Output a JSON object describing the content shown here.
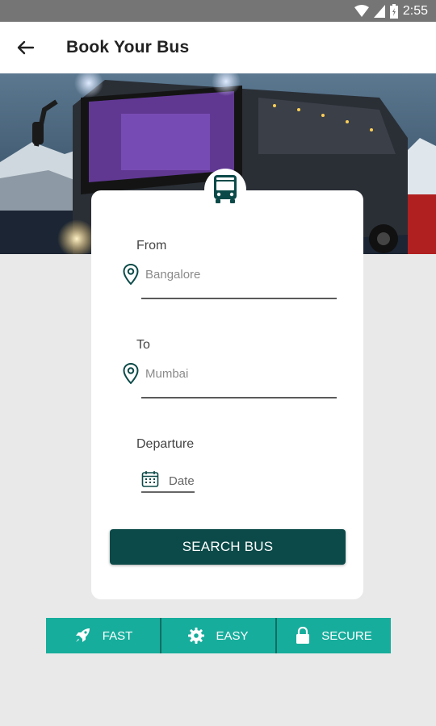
{
  "status_bar": {
    "time": "2:55"
  },
  "app_bar": {
    "title": "Book Your Bus"
  },
  "form": {
    "from_label": "From",
    "from_value": "Bangalore",
    "to_label": "To",
    "to_value": "Mumbai",
    "departure_label": "Departure",
    "date_placeholder": "Date",
    "search_button": "SEARCH BUS"
  },
  "features": [
    {
      "label": "FAST",
      "icon": "rocket-icon"
    },
    {
      "label": "EASY",
      "icon": "gear-icon"
    },
    {
      "label": "SECURE",
      "icon": "lock-icon"
    }
  ],
  "colors": {
    "primary_dark": "#0b4a48",
    "accent_teal": "#17ad9c",
    "status_bar": "#757575"
  }
}
